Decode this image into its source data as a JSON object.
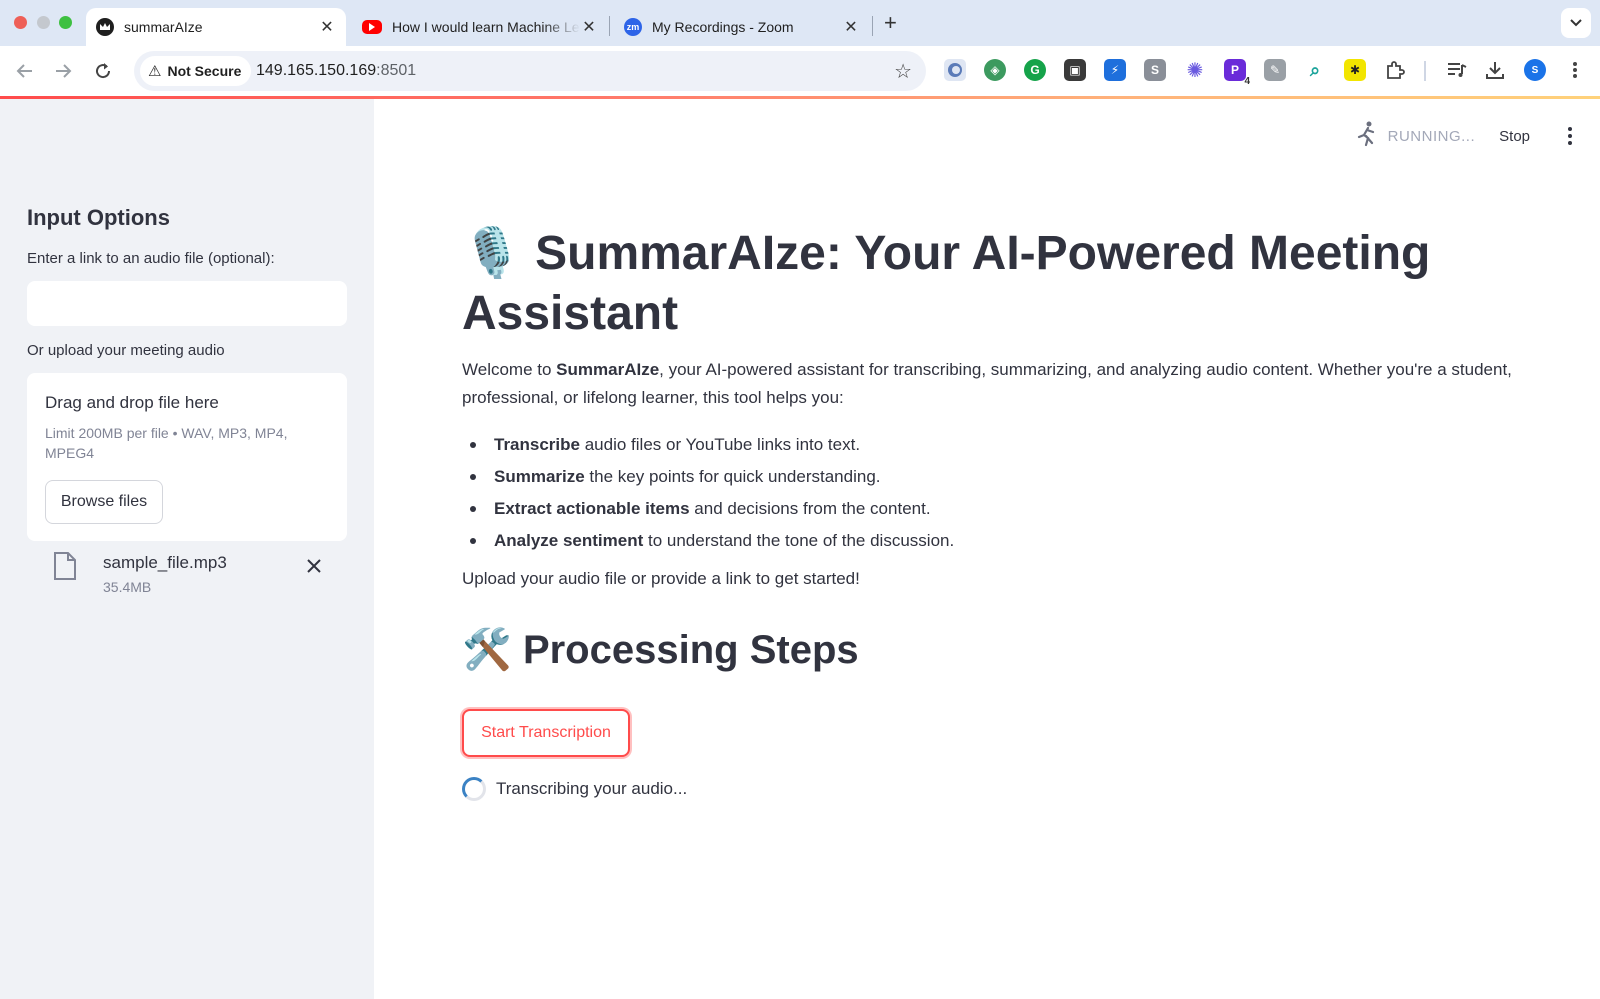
{
  "browser": {
    "tabs": [
      {
        "title": "summarAIze",
        "icon": "streamlit-crown-icon",
        "active": true
      },
      {
        "title": "How I would learn Machine Le",
        "icon": "youtube-icon",
        "active": false
      },
      {
        "title": "My Recordings - Zoom",
        "icon": "zoom-icon",
        "active": false
      }
    ],
    "zoom_favicon_text": "zm",
    "security_label": "Not Secure",
    "url_host": "149.165.150.169",
    "url_port": ":8501",
    "extension_badge": "4",
    "profile_initial": "S"
  },
  "app": {
    "status": {
      "running_label": "RUNNING...",
      "stop_label": "Stop"
    },
    "sidebar": {
      "title": "Input Options",
      "link_label": "Enter a link to an audio file (optional):",
      "link_value": "",
      "upload_label": "Or upload your meeting audio",
      "dropzone_title": "Drag and drop file here",
      "dropzone_limit": "Limit 200MB per file • WAV, MP3, MP4, MPEG4",
      "browse_label": "Browse files",
      "uploaded_file": {
        "name": "sample_file.mp3",
        "size": "35.4MB"
      }
    },
    "main": {
      "title_emoji": "🎙️",
      "title": "SummarAIze: Your AI-Powered Meeting Assistant",
      "intro_prefix": "Welcome to ",
      "intro_brand": "SummarAIze",
      "intro_suffix": ", your AI-powered assistant for transcribing, summarizing, and analyzing audio content. Whether you're a student, professional, or lifelong learner, this tool helps you:",
      "features": [
        {
          "bold": "Transcribe",
          "text": " audio files or YouTube links into text."
        },
        {
          "bold": "Summarize",
          "text": " the key points for quick understanding."
        },
        {
          "bold": "Extract actionable items",
          "text": " and decisions from the content."
        },
        {
          "bold": "Analyze sentiment",
          "text": " to understand the tone of the discussion."
        }
      ],
      "cta": "Upload your audio file or provide a link to get started!",
      "section_emoji": "🛠️",
      "section_title": "Processing Steps",
      "start_button": "Start Transcription",
      "spinner_text": "Transcribing your audio..."
    }
  },
  "colors": {
    "primary": "#ff4b4b",
    "sidebar_bg": "#f0f2f6",
    "text": "#31333f",
    "chrome_bg": "#dee7f5"
  }
}
